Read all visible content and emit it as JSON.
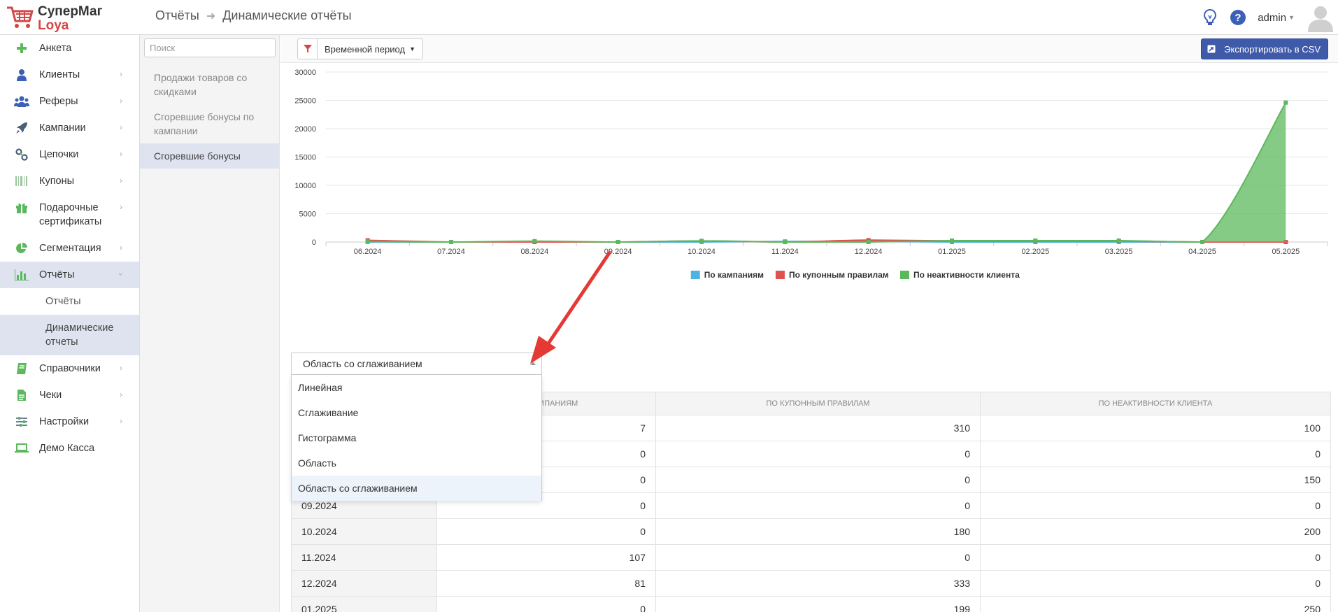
{
  "header": {
    "brand_line1": "СуперМаг",
    "brand_line2": "Loya",
    "breadcrumb": [
      "Отчёты",
      "Динамические отчёты"
    ],
    "user": "admin"
  },
  "sidebar": {
    "items": [
      {
        "label": "Анкета",
        "icon": "plus-icon",
        "chevron": false
      },
      {
        "label": "Клиенты",
        "icon": "user-icon",
        "chevron": true
      },
      {
        "label": "Реферы",
        "icon": "users-group-icon",
        "chevron": true
      },
      {
        "label": "Кампании",
        "icon": "rocket-icon",
        "chevron": true
      },
      {
        "label": "Цепочки",
        "icon": "link-icon",
        "chevron": true
      },
      {
        "label": "Купоны",
        "icon": "barcode-icon",
        "chevron": true
      },
      {
        "label": "Подарочные сертификаты",
        "icon": "gift-icon",
        "chevron": true
      },
      {
        "label": "Сегментация",
        "icon": "pie-chart-icon",
        "chevron": true
      },
      {
        "label": "Отчёты",
        "icon": "bar-chart-icon",
        "chevron": true,
        "active": true
      },
      {
        "label": "Справочники",
        "icon": "book-icon",
        "chevron": true
      },
      {
        "label": "Чеки",
        "icon": "receipt-icon",
        "chevron": true
      },
      {
        "label": "Настройки",
        "icon": "sliders-icon",
        "chevron": true
      },
      {
        "label": "Демо Касса",
        "icon": "laptop-icon",
        "chevron": false
      }
    ],
    "report_subitems": [
      {
        "label": "Отчёты",
        "active": false
      },
      {
        "label": "Динамические отчеты",
        "active": true
      }
    ]
  },
  "reports": {
    "search_placeholder": "Поиск",
    "items": [
      {
        "label": "Продажи товаров со скидками",
        "active": false
      },
      {
        "label": "Сгоревшие бонусы по кампании",
        "active": false
      },
      {
        "label": "Сгоревшие бонусы",
        "active": true
      }
    ]
  },
  "toolbar": {
    "period_label": "Временной период",
    "export_label": "Экспортировать в CSV"
  },
  "chart_data": {
    "type": "area",
    "categories": [
      "06.2024",
      "07.2024",
      "08.2024",
      "09.2024",
      "10.2024",
      "11.2024",
      "12.2024",
      "01.2025",
      "02.2025",
      "03.2025",
      "04.2025",
      "05.2025"
    ],
    "ylim": [
      0,
      30000
    ],
    "yticks": [
      "0",
      "5000",
      "10000",
      "15000",
      "20000",
      "25000",
      "30000"
    ],
    "grid": true,
    "legend_position": "bottom",
    "series": [
      {
        "name": "По кампаниям",
        "color": "#4eb3e0",
        "values": [
          7,
          0,
          0,
          0,
          0,
          107,
          81,
          0,
          0,
          0,
          0,
          0
        ]
      },
      {
        "name": "По купонным правилам",
        "color": "#e0524f",
        "values": [
          310,
          0,
          0,
          0,
          180,
          0,
          333,
          199,
          150,
          150,
          0,
          0
        ]
      },
      {
        "name": "По неактивности клиента",
        "color": "#5cb85c",
        "values": [
          100,
          0,
          150,
          0,
          200,
          0,
          0,
          250,
          250,
          250,
          0,
          24600
        ]
      }
    ]
  },
  "chart_type_select": {
    "value": "Область со сглаживанием",
    "options": [
      "Линейная",
      "Сглаживание",
      "Гистограмма",
      "Область",
      "Область со сглаживанием"
    ],
    "selected_index": 4
  },
  "table": {
    "headers": [
      "По кампаниям",
      "По купонным правилам",
      "По неактивности клиента"
    ],
    "rows": [
      {
        "period": "",
        "values": [
          "7",
          "310",
          "100"
        ]
      },
      {
        "period": "",
        "values": [
          "0",
          "0",
          "0"
        ]
      },
      {
        "period": "",
        "values": [
          "0",
          "0",
          "150"
        ]
      },
      {
        "period": "09.2024",
        "values": [
          "0",
          "0",
          "0"
        ]
      },
      {
        "period": "10.2024",
        "values": [
          "0",
          "180",
          "200"
        ]
      },
      {
        "period": "11.2024",
        "values": [
          "107",
          "0",
          "0"
        ]
      },
      {
        "period": "12.2024",
        "values": [
          "81",
          "333",
          "0"
        ]
      },
      {
        "period": "01.2025",
        "values": [
          "0",
          "199",
          "250"
        ]
      }
    ]
  }
}
